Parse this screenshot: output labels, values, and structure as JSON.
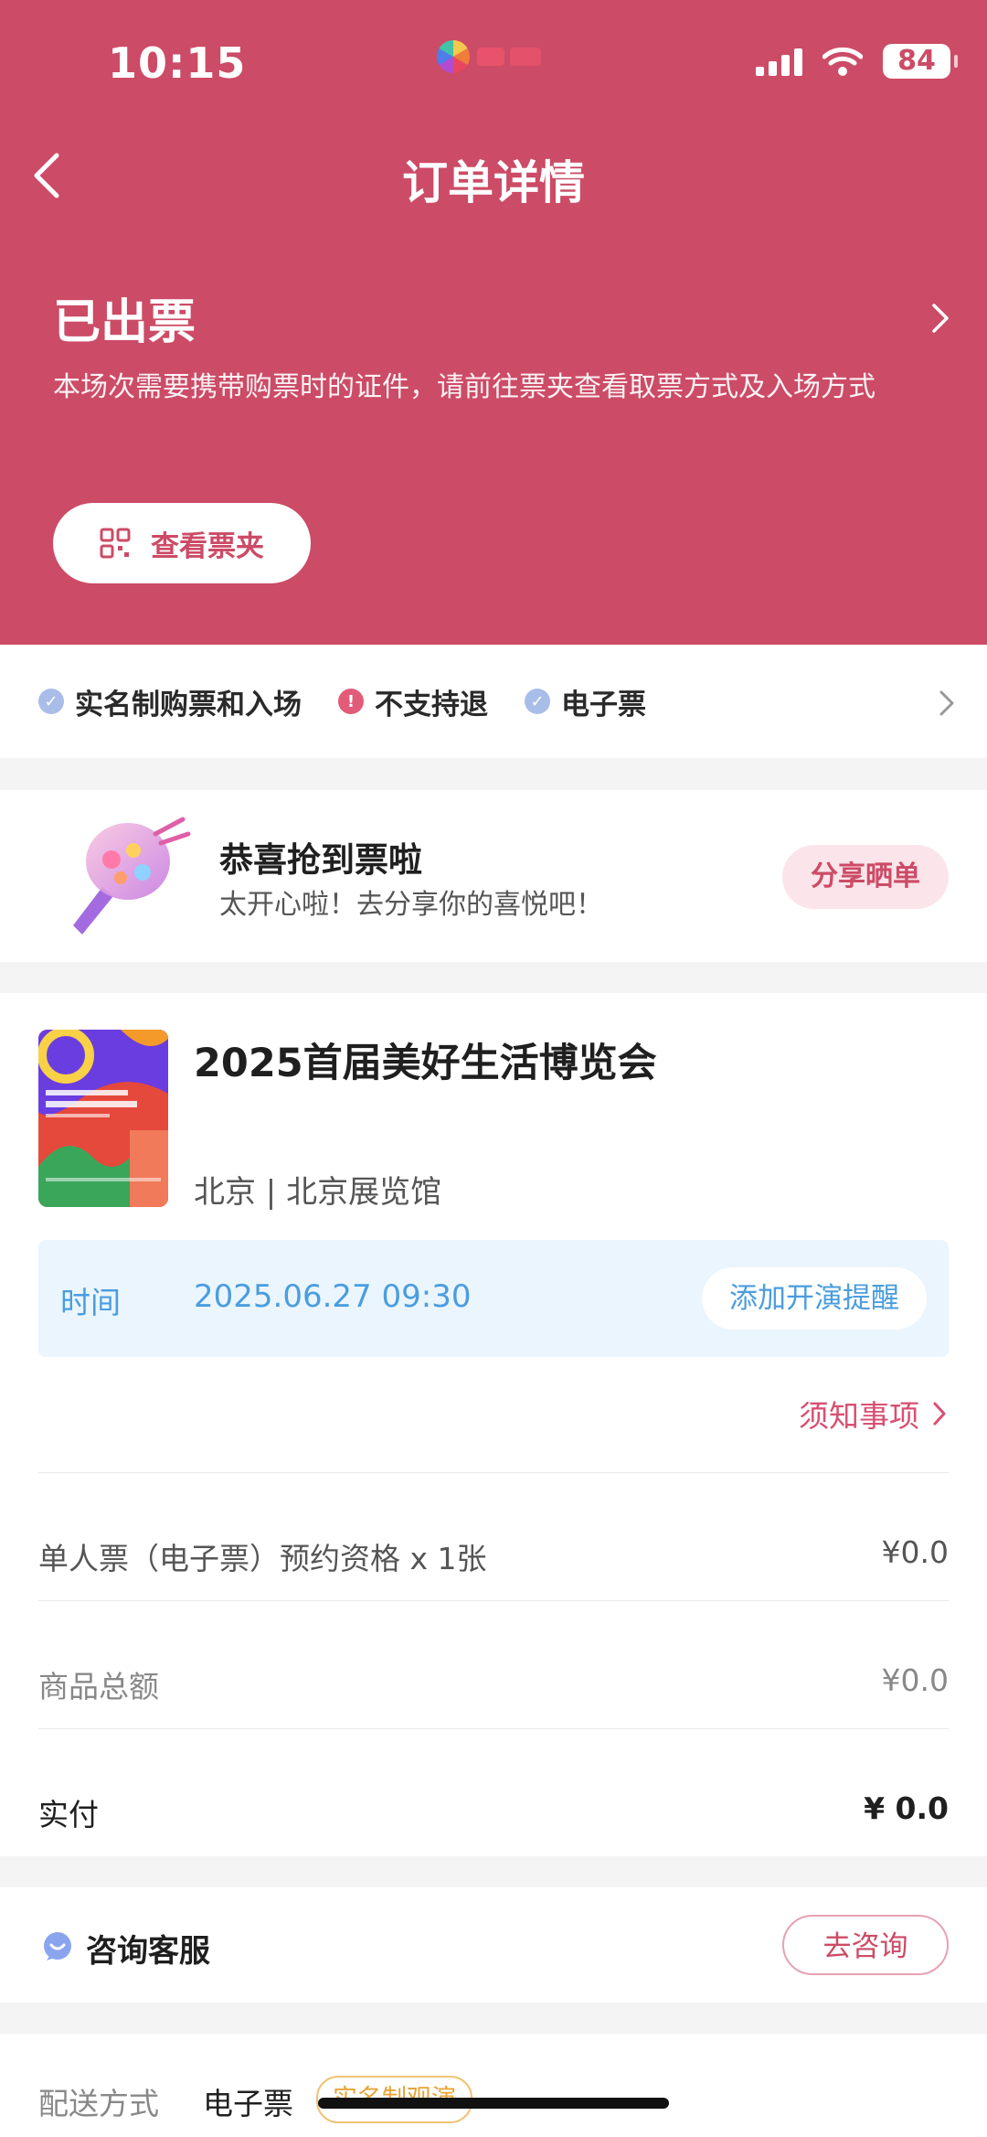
{
  "status_bar": {
    "time": "10:15",
    "battery": "84"
  },
  "nav": {
    "title": "订单详情"
  },
  "order_status": {
    "title": "已出票",
    "description": "本场次需要携带购票时的证件，请前往票夹查看取票方式及入场方式",
    "ticket_button": "查看票夹"
  },
  "policies": [
    {
      "label": "实名制购票和入场",
      "icon": "check-icon"
    },
    {
      "label": "不支持退",
      "icon": "alert-icon"
    },
    {
      "label": "电子票",
      "icon": "check-icon"
    }
  ],
  "share": {
    "title": "恭喜抢到票啦",
    "subtitle": "太开心啦！去分享你的喜悦吧！",
    "button": "分享晒单"
  },
  "event": {
    "title": "2025首届美好生活博览会",
    "venue": "北京 | 北京展览馆",
    "time_label": "时间",
    "time_value": "2025.06.27 09:30",
    "remind_button": "添加开演提醒",
    "notice": "须知事项"
  },
  "prices": {
    "item_label": "单人票（电子票）预约资格 x 1张",
    "item_value": "¥0.0",
    "subtotal_label": "商品总额",
    "subtotal_value": "¥0.0",
    "paid_label": "实付",
    "paid_value": "¥ 0.0"
  },
  "consult": {
    "label": "咨询客服",
    "button": "去咨询"
  },
  "delivery": {
    "label": "配送方式",
    "value": "电子票",
    "tag": "实名制观演"
  },
  "colors": {
    "brand": "#cc4b66",
    "info_blue": "#4a9ddf",
    "tag_orange": "#e8a338"
  }
}
